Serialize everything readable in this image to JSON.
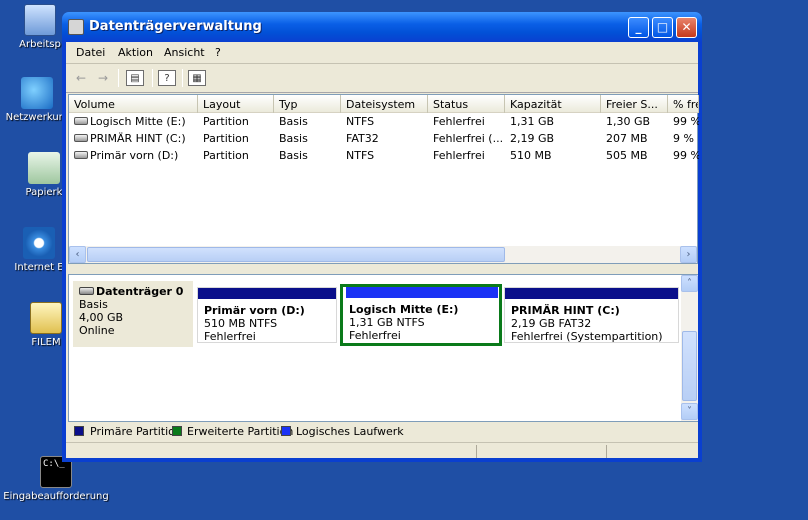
{
  "desktop": {
    "icons": [
      {
        "label": "Arbeitsp"
      },
      {
        "label": "Netzwerkum"
      },
      {
        "label": "Papierk"
      },
      {
        "label": "Internet E"
      },
      {
        "label": "FILEM"
      },
      {
        "label": "Eingabeaufforderung"
      }
    ]
  },
  "window": {
    "title": "Datenträgerverwaltung",
    "controls": {
      "minimize": "_",
      "maximize": "□",
      "close": "✕"
    }
  },
  "menu": [
    "Datei",
    "Aktion",
    "Ansicht",
    "?"
  ],
  "toolbar": {
    "back": "←",
    "forward": "→"
  },
  "volume_list": {
    "columns": [
      "Volume",
      "Layout",
      "Typ",
      "Dateisystem",
      "Status",
      "Kapazität",
      "Freier S...",
      "% fre"
    ],
    "rows": [
      [
        "Logisch Mitte (E:)",
        "Partition",
        "Basis",
        "NTFS",
        "Fehlerfrei",
        "1,31 GB",
        "1,30 GB",
        "99 %"
      ],
      [
        "PRIMÄR HINT (C:)",
        "Partition",
        "Basis",
        "FAT32",
        "Fehlerfrei (...",
        "2,19 GB",
        "207 MB",
        "9 %"
      ],
      [
        "Primär vorn (D:)",
        "Partition",
        "Basis",
        "NTFS",
        "Fehlerfrei",
        "510 MB",
        "505 MB",
        "99 %"
      ]
    ]
  },
  "disk": {
    "name": "Datenträger 0",
    "type": "Basis",
    "size": "4,00 GB",
    "state": "Online",
    "partitions": [
      {
        "name": "Primär vorn  (D:)",
        "info": "510 MB NTFS",
        "status": "Fehlerfrei",
        "bar_color": "#0a0f8a"
      },
      {
        "name": "Logisch Mitte  (E:)",
        "info": "1,31 GB NTFS",
        "status": "Fehlerfrei",
        "bar_color": "#1a32f5"
      },
      {
        "name": "PRIMÄR HINT  (C:)",
        "info": "2,19 GB FAT32",
        "status": "Fehlerfrei (Systempartition)",
        "bar_color": "#0a0f8a"
      }
    ]
  },
  "legend": [
    {
      "label": "Primäre Partition",
      "color": "#0a0f8a"
    },
    {
      "label": "Erweiterte Partition",
      "color": "#0a7a1a"
    },
    {
      "label": "Logisches Laufwerk",
      "color": "#1a32f5"
    }
  ]
}
